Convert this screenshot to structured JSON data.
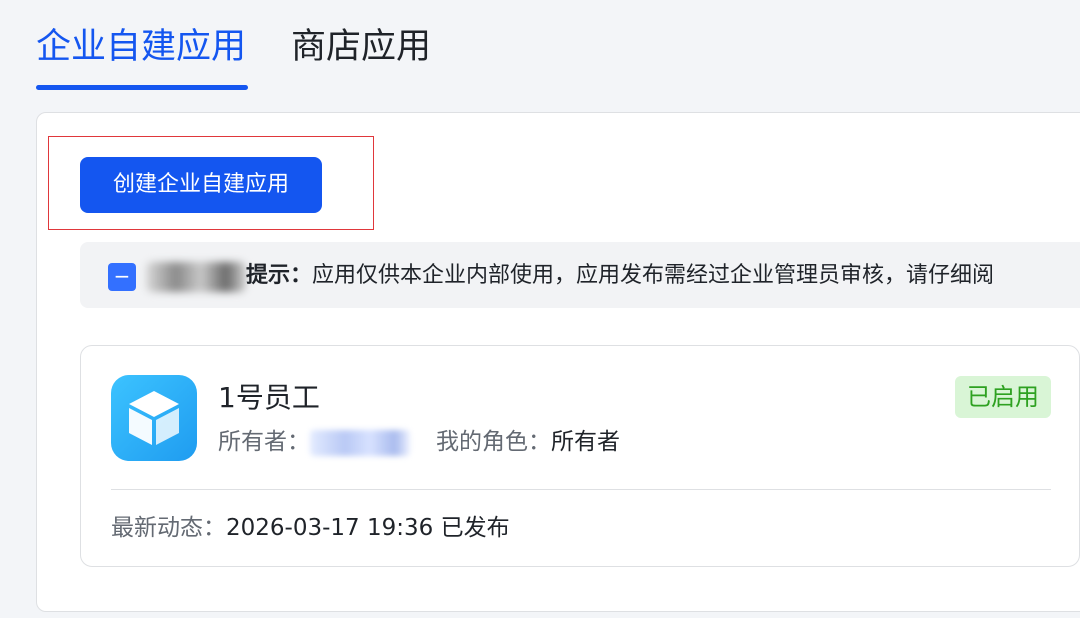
{
  "tabs": [
    {
      "label": "企业自建应用",
      "active": true
    },
    {
      "label": "商店应用",
      "active": false
    }
  ],
  "create_button": {
    "label": "创建企业自建应用"
  },
  "notice": {
    "label": "提示：",
    "text": "应用仅供本企业内部使用，应用发布需经过企业管理员审核，请仔细阅"
  },
  "app": {
    "name": "1号员工",
    "status": "已启用",
    "owner_label": "所有者：",
    "role_label": "我的角色：",
    "role_value": "所有者",
    "latest_label": "最新动态：",
    "latest_value": "2026-03-17 19:36 已发布",
    "icon": "cube-icon"
  },
  "colors": {
    "accent": "#1456f0",
    "status_bg": "#d9f5d6",
    "status_text": "#2ea121",
    "highlight": "#e0373b"
  }
}
